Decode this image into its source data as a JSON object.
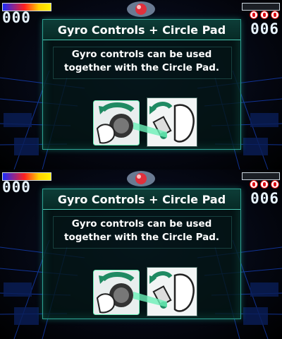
{
  "top": {
    "score_left": "000",
    "score_right": "006",
    "lives_icons": [
      "life-icon",
      "life-icon",
      "life-icon"
    ],
    "dialog": {
      "title": "Gyro Controls + Circle Pad",
      "message_line1": "Gyro controls can be used",
      "message_line2": "together with the Circle Pad."
    }
  },
  "bottom": {
    "score_left": "000",
    "score_right": "006",
    "lives_icons": [
      "life-icon",
      "life-icon",
      "life-icon"
    ],
    "dialog": {
      "title": "Gyro Controls + Circle Pad",
      "message_line1": "Gyro controls can be used",
      "message_line2": "together with the Circle Pad."
    }
  },
  "colors": {
    "panel_border": "#2fa594",
    "accent_green": "#6cf0b8",
    "grid_blue": "#1c57ff"
  }
}
